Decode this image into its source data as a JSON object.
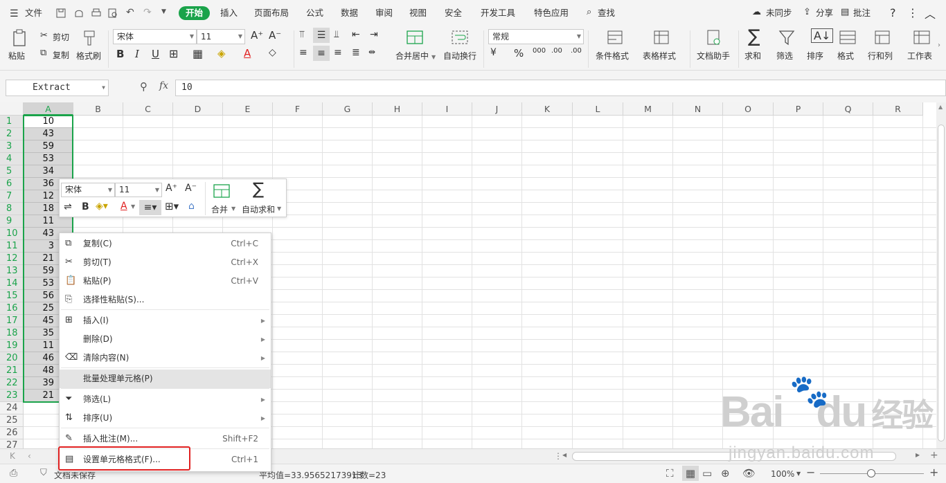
{
  "menubar": {
    "file": "文件",
    "tabs": [
      "开始",
      "插入",
      "页面布局",
      "公式",
      "数据",
      "审阅",
      "视图",
      "安全",
      "开发工具",
      "特色应用"
    ],
    "search": "查找",
    "sync": "未同步",
    "share": "分享",
    "comment": "批注"
  },
  "ribbon": {
    "paste": "粘贴",
    "cut": "剪切",
    "copy": "复制",
    "format_painter": "格式刷",
    "font": "宋体",
    "size": "11",
    "merge": "合并居中",
    "wrap": "自动换行",
    "number_format": "常规",
    "cond_format": "条件格式",
    "table_style": "表格样式",
    "doc_helper": "文档助手",
    "sum": "求和",
    "filter": "筛选",
    "sort": "排序",
    "format": "格式",
    "rowcol": "行和列",
    "sheet": "工作表"
  },
  "formula_bar": {
    "name_box": "Extract",
    "fx": "fx",
    "value": "10"
  },
  "columns": [
    "A",
    "B",
    "C",
    "D",
    "E",
    "F",
    "G",
    "H",
    "I",
    "J",
    "K",
    "L",
    "M",
    "N",
    "O",
    "P",
    "Q",
    "R"
  ],
  "rows": [
    "1",
    "2",
    "3",
    "4",
    "5",
    "6",
    "7",
    "8",
    "9",
    "10",
    "11",
    "12",
    "13",
    "14",
    "15",
    "16",
    "17",
    "18",
    "19",
    "20",
    "21",
    "22",
    "23",
    "24",
    "25",
    "26",
    "27"
  ],
  "col_a_values": [
    "10",
    "43",
    "59",
    "53",
    "34",
    "36",
    "12",
    "18",
    "11",
    "43",
    "3",
    "21",
    "59",
    "53",
    "56",
    "25",
    "45",
    "35",
    "11",
    "46",
    "48",
    "39",
    "21"
  ],
  "mini_toolbar": {
    "font": "宋体",
    "size": "11",
    "merge": "合并",
    "autosum": "自动求和",
    "bold": "B"
  },
  "context_menu": [
    {
      "label": "复制(C)",
      "shortcut": "Ctrl+C",
      "icon": "copy-icon",
      "sub": false
    },
    {
      "label": "剪切(T)",
      "shortcut": "Ctrl+X",
      "icon": "scissors-icon",
      "sub": false
    },
    {
      "label": "粘贴(P)",
      "shortcut": "Ctrl+V",
      "icon": "paste-icon",
      "sub": false
    },
    {
      "label": "选择性粘贴(S)...",
      "shortcut": "",
      "icon": "paste-special-icon",
      "sub": false
    },
    {
      "label": "插入(I)",
      "shortcut": "",
      "icon": "insert-icon",
      "sub": true
    },
    {
      "label": "删除(D)",
      "shortcut": "",
      "icon": "",
      "sub": true
    },
    {
      "label": "清除内容(N)",
      "shortcut": "",
      "icon": "eraser-icon",
      "sub": true
    },
    {
      "label": "批量处理单元格(P)",
      "shortcut": "",
      "icon": "",
      "sub": false
    },
    {
      "label": "筛选(L)",
      "shortcut": "",
      "icon": "filter-icon",
      "sub": true
    },
    {
      "label": "排序(U)",
      "shortcut": "",
      "icon": "sort-icon",
      "sub": true
    },
    {
      "label": "插入批注(M)...",
      "shortcut": "Shift+F2",
      "icon": "comment-icon",
      "sub": false
    },
    {
      "label": "设置单元格格式(F)...",
      "shortcut": "Ctrl+1",
      "icon": "format-cells-icon",
      "sub": false
    }
  ],
  "status": {
    "avg": "平均值=33.95652173913",
    "count": "计数=23",
    "zoom": "100%",
    "doc_label": "文档未保存"
  },
  "watermark": {
    "brand": "Bai",
    "brand2": "du",
    "cn": "经验",
    "url": "jingyan.baidu.com"
  }
}
